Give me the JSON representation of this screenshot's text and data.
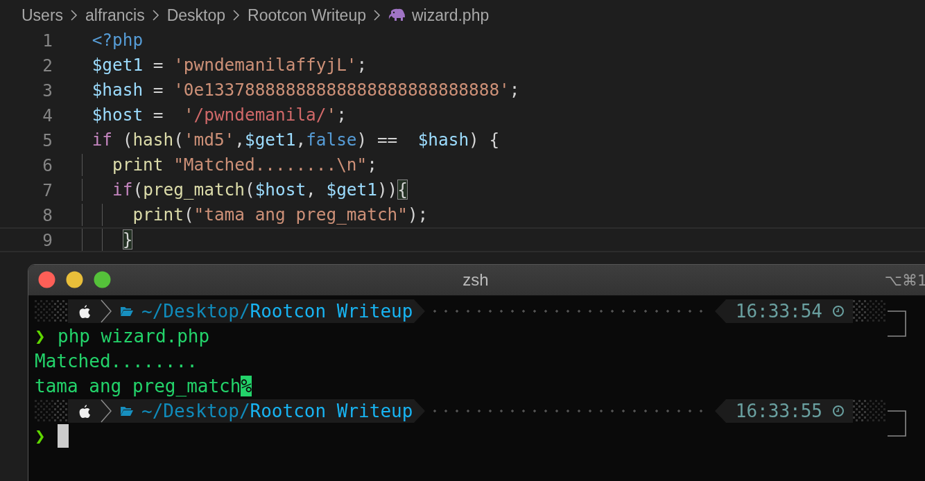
{
  "breadcrumb": [
    {
      "label": "Users",
      "kind": "folder"
    },
    {
      "label": "alfrancis",
      "kind": "folder"
    },
    {
      "label": "Desktop",
      "kind": "folder"
    },
    {
      "label": "Rootcon Writeup",
      "kind": "folder"
    },
    {
      "label": "wizard.php",
      "kind": "file"
    }
  ],
  "editor": {
    "lines": [
      {
        "number": "1",
        "current": false,
        "tokens": [
          {
            "kind": "tag",
            "text": "<?php"
          }
        ]
      },
      {
        "number": "2",
        "current": false,
        "tokens": [
          {
            "kind": "variable",
            "text": "$get1"
          },
          {
            "kind": "plain",
            "text": " = "
          },
          {
            "kind": "string",
            "text": "'pwndemanilaffyjL'"
          },
          {
            "kind": "plain",
            "text": ";"
          }
        ]
      },
      {
        "number": "3",
        "current": false,
        "tokens": [
          {
            "kind": "variable",
            "text": "$hash"
          },
          {
            "kind": "plain",
            "text": " = "
          },
          {
            "kind": "string",
            "text": "'0e13378888888888888888888888888'"
          },
          {
            "kind": "plain",
            "text": ";"
          }
        ]
      },
      {
        "number": "4",
        "current": false,
        "tokens": [
          {
            "kind": "variable",
            "text": "$host"
          },
          {
            "kind": "plain",
            "text": " =  "
          },
          {
            "kind": "string",
            "text": "'"
          },
          {
            "kind": "regex",
            "text": "/pwndemanila/"
          },
          {
            "kind": "string",
            "text": "'"
          },
          {
            "kind": "plain",
            "text": ";"
          }
        ]
      },
      {
        "number": "5",
        "current": false,
        "tokens": [
          {
            "kind": "keyword",
            "text": "if"
          },
          {
            "kind": "plain",
            "text": " ("
          },
          {
            "kind": "function",
            "text": "hash"
          },
          {
            "kind": "plain",
            "text": "("
          },
          {
            "kind": "string",
            "text": "'md5'"
          },
          {
            "kind": "plain",
            "text": ","
          },
          {
            "kind": "variable",
            "text": "$get1"
          },
          {
            "kind": "plain",
            "text": ","
          },
          {
            "kind": "constant",
            "text": "false"
          },
          {
            "kind": "plain",
            "text": ") ==  "
          },
          {
            "kind": "variable",
            "text": "$hash"
          },
          {
            "kind": "plain",
            "text": ") {"
          }
        ]
      },
      {
        "number": "6",
        "current": false,
        "tokens": [
          {
            "kind": "function",
            "text": "  print"
          },
          {
            "kind": "string",
            "text": " \"Matched........\\n\""
          },
          {
            "kind": "plain",
            "text": ";"
          }
        ]
      },
      {
        "number": "7",
        "current": false,
        "tokens": [
          {
            "kind": "keyword",
            "text": "  if"
          },
          {
            "kind": "plain",
            "text": "("
          },
          {
            "kind": "function",
            "text": "preg_match"
          },
          {
            "kind": "plain",
            "text": "("
          },
          {
            "kind": "variable",
            "text": "$host"
          },
          {
            "kind": "plain",
            "text": ", "
          },
          {
            "kind": "variable",
            "text": "$get1"
          },
          {
            "kind": "plain",
            "text": "))"
          },
          {
            "kind": "plain",
            "text": "{",
            "matched": true
          }
        ]
      },
      {
        "number": "8",
        "current": false,
        "tokens": [
          {
            "kind": "function",
            "text": "    print"
          },
          {
            "kind": "plain",
            "text": "("
          },
          {
            "kind": "string",
            "text": "\"tama ang preg_match\""
          },
          {
            "kind": "plain",
            "text": ");"
          }
        ]
      },
      {
        "number": "9",
        "current": true,
        "tokens": [
          {
            "kind": "plain",
            "text": "   }",
            "matched": true
          }
        ]
      }
    ]
  },
  "terminal": {
    "title": "zsh",
    "shortcut": "⌥⌘1",
    "lines": [
      {
        "kind": "prompt",
        "path_parent": "~/Desktop/",
        "path_dir": "Rootcon Writeup",
        "time": "16:33:54"
      },
      {
        "kind": "command",
        "symbol": "❯",
        "text": "php wizard.php"
      },
      {
        "kind": "output",
        "text": "Matched........"
      },
      {
        "kind": "output",
        "text": "tama ang preg_match",
        "end_mark": "%"
      },
      {
        "kind": "prompt",
        "path_parent": "~/Desktop/",
        "path_dir": "Rootcon Writeup",
        "time": "16:33:55"
      },
      {
        "kind": "input",
        "symbol": "❯"
      }
    ]
  }
}
